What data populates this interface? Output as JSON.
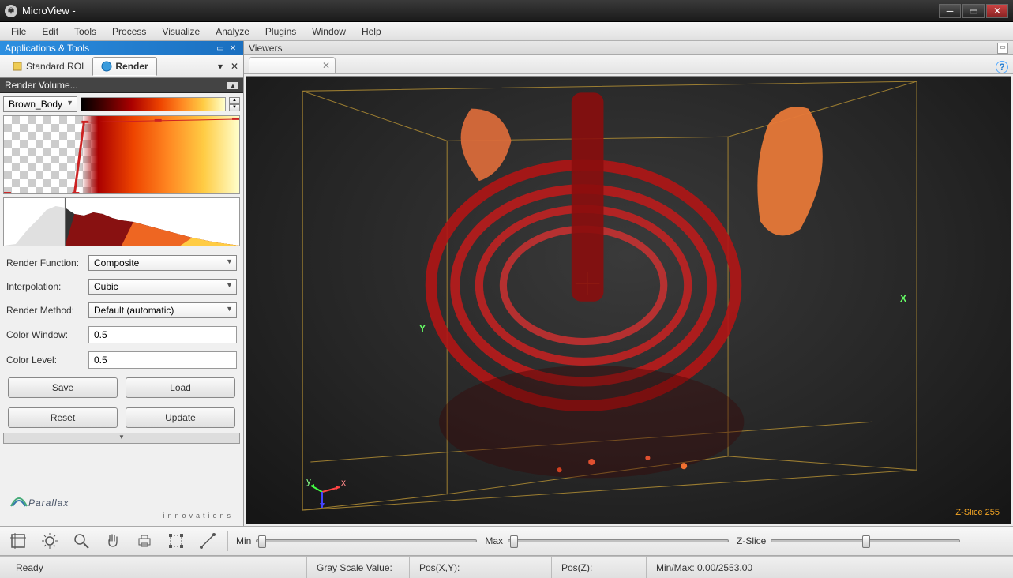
{
  "window": {
    "title": "MicroView -"
  },
  "menu": [
    "File",
    "Edit",
    "Tools",
    "Process",
    "Visualize",
    "Analyze",
    "Plugins",
    "Window",
    "Help"
  ],
  "left_panel": {
    "header": "Applications & Tools",
    "tabs": [
      {
        "label": "Standard ROI",
        "active": false
      },
      {
        "label": "Render",
        "active": true
      }
    ],
    "section": "Render Volume...",
    "colormap_select": "Brown_Body",
    "render_function": {
      "label": "Render Function:",
      "value": "Composite"
    },
    "interpolation": {
      "label": "Interpolation:",
      "value": "Cubic"
    },
    "render_method": {
      "label": "Render Method:",
      "value": "Default (automatic)"
    },
    "color_window": {
      "label": "Color Window:",
      "value": "0.5"
    },
    "color_level": {
      "label": "Color Level:",
      "value": "0.5"
    },
    "buttons": {
      "save": "Save",
      "load": "Load",
      "reset": "Reset",
      "update": "Update"
    },
    "logo": {
      "name": "Parallax",
      "sub": "innovations"
    }
  },
  "viewers": {
    "header": "Viewers",
    "tab_label": "                     ",
    "axis_x": "X",
    "axis_y": "Y",
    "zslice": "Z-Slice 255"
  },
  "toolbar": {
    "min_label": "Min",
    "max_label": "Max",
    "zslice_label": "Z-Slice"
  },
  "statusbar": {
    "ready": "Ready",
    "gray": "Gray Scale Value:",
    "posxy": "Pos(X,Y):",
    "posz": "Pos(Z):",
    "minmax": "Min/Max: 0.00/2553.00"
  }
}
